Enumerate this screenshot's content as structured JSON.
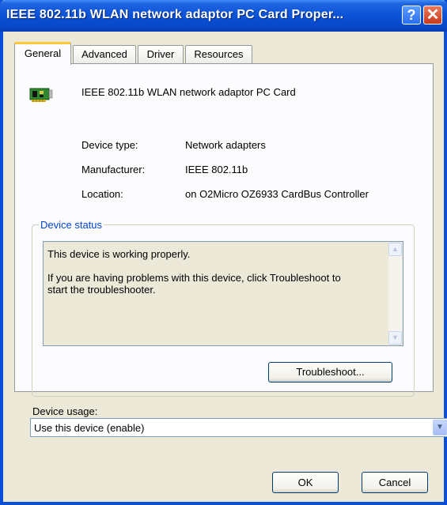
{
  "window": {
    "title": "IEEE 802.11b WLAN network adaptor PC Card Proper...",
    "help_glyph": "?",
    "close_glyph": "✕"
  },
  "tabs": [
    {
      "label": "General",
      "active": true
    },
    {
      "label": "Advanced",
      "active": false
    },
    {
      "label": "Driver",
      "active": false
    },
    {
      "label": "Resources",
      "active": false
    }
  ],
  "device": {
    "name": "IEEE 802.11b WLAN network adaptor PC Card",
    "icon": "network-card-icon",
    "properties": [
      {
        "label": "Device type:",
        "value": "Network adapters"
      },
      {
        "label": "Manufacturer:",
        "value": "IEEE 802.11b"
      },
      {
        "label": "Location:",
        "value": "on O2Micro OZ6933 CardBus Controller"
      }
    ]
  },
  "status": {
    "legend": "Device status",
    "line1": "This device is working properly.",
    "line2": "If you are having problems with this device, click Troubleshoot to",
    "line3": "start the troubleshooter.",
    "troubleshoot_label": "Troubleshoot..."
  },
  "usage": {
    "label": "Device usage:",
    "selected": "Use this device (enable)"
  },
  "buttons": {
    "ok": "OK",
    "cancel": "Cancel"
  },
  "colors": {
    "titlebar": "#0a52d6",
    "dialog_bg": "#ece9d8",
    "legend_text": "#0046d5",
    "active_tab_accent": "#ffc83c"
  }
}
